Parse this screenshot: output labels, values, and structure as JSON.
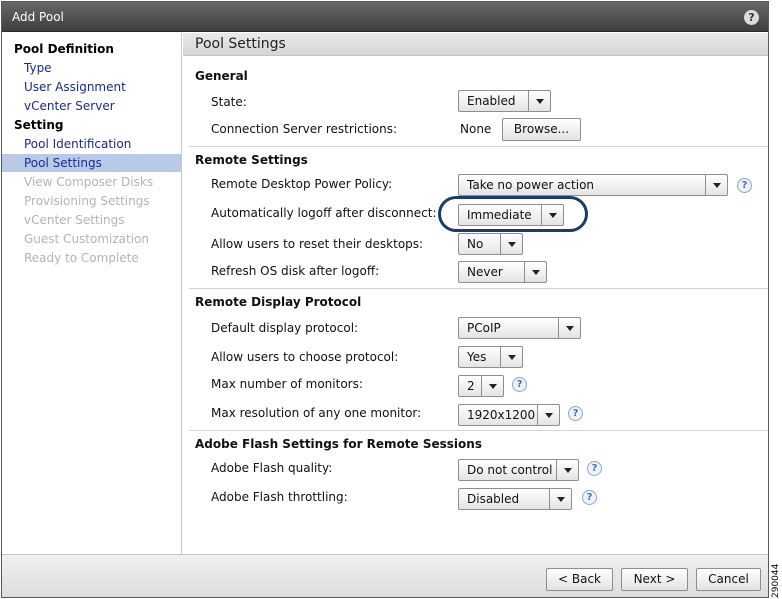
{
  "window": {
    "title": "Add Pool"
  },
  "sidebar": {
    "sections": [
      {
        "heading": "Pool Definition",
        "items": [
          "Type",
          "User Assignment",
          "vCenter Server"
        ]
      },
      {
        "heading": "Setting",
        "items": [
          "Pool Identification",
          "Pool Settings",
          "View Composer Disks",
          "Provisioning Settings",
          "vCenter Settings",
          "Guest Customization",
          "Ready to Complete"
        ]
      }
    ],
    "active_item": "Pool Settings"
  },
  "main": {
    "header": "Pool Settings",
    "general": {
      "title": "General",
      "state_label": "State:",
      "state_value": "Enabled",
      "restrictions_label": "Connection Server restrictions:",
      "restrictions_value": "None",
      "browse_label": "Browse..."
    },
    "remote": {
      "title": "Remote Settings",
      "power_label": "Remote Desktop Power Policy:",
      "power_value": "Take no power action",
      "logoff_label": "Automatically logoff after disconnect:",
      "logoff_value": "Immediate",
      "reset_label": "Allow users to reset their desktops:",
      "reset_value": "No",
      "refresh_label": "Refresh OS disk after logoff:",
      "refresh_value": "Never"
    },
    "display": {
      "title": "Remote Display Protocol",
      "protocol_label": "Default display protocol:",
      "protocol_value": "PCoIP",
      "choose_label": "Allow users to choose protocol:",
      "choose_value": "Yes",
      "monitors_label": "Max number of monitors:",
      "monitors_value": "2",
      "resolution_label": "Max resolution of any one monitor:",
      "resolution_value": "1920x1200"
    },
    "flash": {
      "title": "Adobe Flash Settings for Remote Sessions",
      "quality_label": "Adobe Flash quality:",
      "quality_value": "Do not control",
      "throttling_label": "Adobe Flash throttling:",
      "throttling_value": "Disabled"
    }
  },
  "footer": {
    "back_label": "< Back",
    "next_label": "Next >",
    "cancel_label": "Cancel"
  },
  "figure_id": "290044",
  "colors": {
    "titlebar": "#4a4a4a",
    "active_item": "#b9c9e8",
    "link": "#1a2a8a",
    "highlight_oval": "#1d3a6e"
  }
}
